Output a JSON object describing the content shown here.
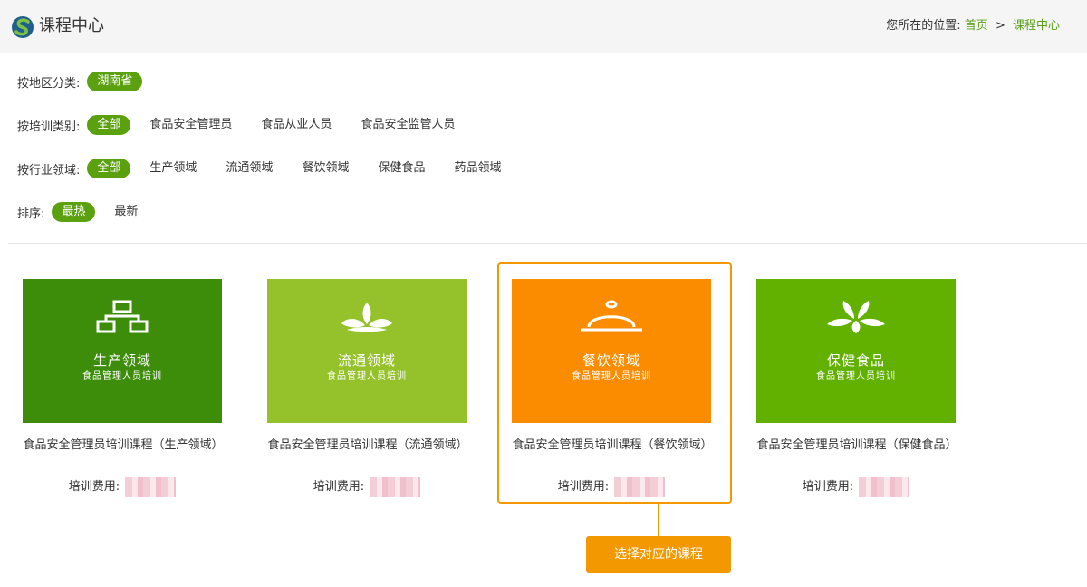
{
  "header": {
    "title": "课程中心",
    "breadcrumb_prefix": "您所在的位置:",
    "breadcrumb_home": "首页",
    "breadcrumb_sep": ">",
    "breadcrumb_current": "课程中心"
  },
  "filters": {
    "region": {
      "label": "按地区分类:",
      "options": [
        "湖南省"
      ]
    },
    "training": {
      "label": "按培训类别:",
      "options": [
        "全部",
        "食品安全管理员",
        "食品从业人员",
        "食品安全监管人员"
      ]
    },
    "industry": {
      "label": "按行业领域:",
      "options": [
        "全部",
        "生产领域",
        "流通领域",
        "餐饮领域",
        "保健食品",
        "药品领域"
      ]
    },
    "sort": {
      "label": "排序:",
      "options": [
        "最热",
        "最新"
      ]
    }
  },
  "courses": [
    {
      "thumb_title": "生产领域",
      "thumb_sub": "食品管理人员培训",
      "name": "食品安全管理员培训课程（生产领域）",
      "fee_label": "培训费用:",
      "color": "#3d8c0a",
      "icon": "org-chart-icon"
    },
    {
      "thumb_title": "流通领域",
      "thumb_sub": "食品管理人员培训",
      "name": "食品安全管理员培训课程（流通领域）",
      "fee_label": "培训费用:",
      "color": "#95c22b",
      "icon": "sprout-icon"
    },
    {
      "thumb_title": "餐饮领域",
      "thumb_sub": "食品管理人员培训",
      "name": "食品安全管理员培训课程（餐饮领域）",
      "fee_label": "培训费用:",
      "color": "#fb8c00",
      "icon": "food-cloche-icon"
    },
    {
      "thumb_title": "保健食品",
      "thumb_sub": "食品管理人员培训",
      "name": "食品安全管理员培训课程（保健食品）",
      "fee_label": "培训费用:",
      "color": "#62b000",
      "icon": "leaves-icon"
    }
  ],
  "tip": {
    "text": "选择对应的课程"
  },
  "colors": {
    "accent": "#5aa00f",
    "highlight": "#f39800"
  }
}
